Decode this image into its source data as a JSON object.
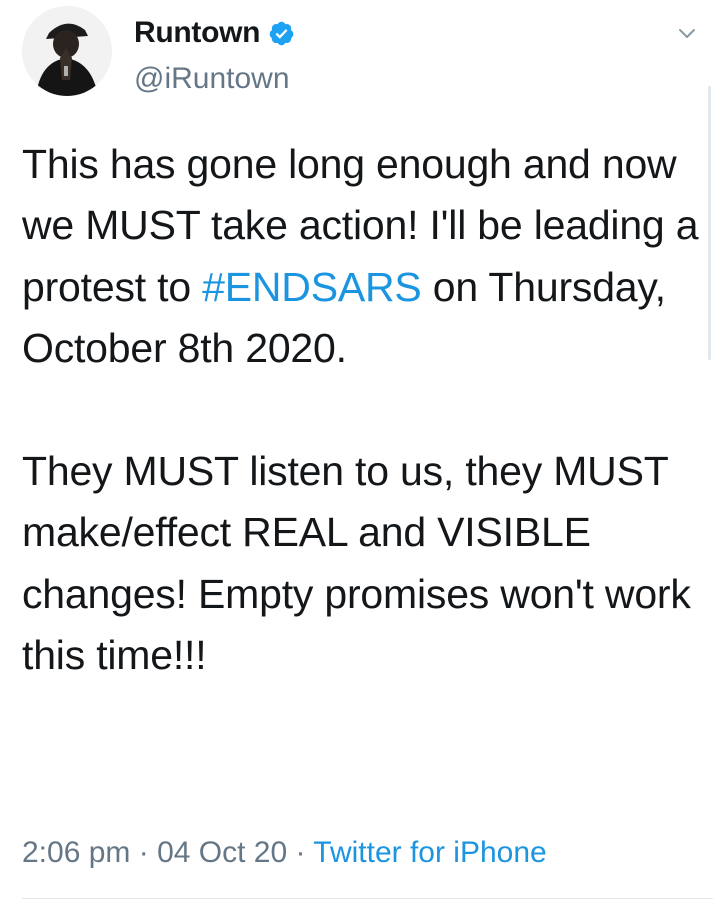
{
  "author": {
    "display_name": "Runtown",
    "handle": "@iRuntown",
    "verified": true,
    "avatar_icon": "profile-photo"
  },
  "menu_icon": "chevron-down-icon",
  "tweet": {
    "text_part1": "This has gone long enough and now we MUST take action! I'll be leading a protest to ",
    "hashtag": "#ENDSARS",
    "text_part2": " on Thursday, October 8th 2020.\n\nThey MUST listen to us, they MUST make/effect REAL and VISIBLE changes! Empty promises won't work this time!!!"
  },
  "meta": {
    "time": "2:06 pm",
    "separator": " · ",
    "date": "04 Oct 20",
    "source": "Twitter for iPhone"
  },
  "colors": {
    "link": "#1b95e0",
    "text": "#14171a",
    "secondary": "#657786",
    "verified": "#1da1f2"
  }
}
